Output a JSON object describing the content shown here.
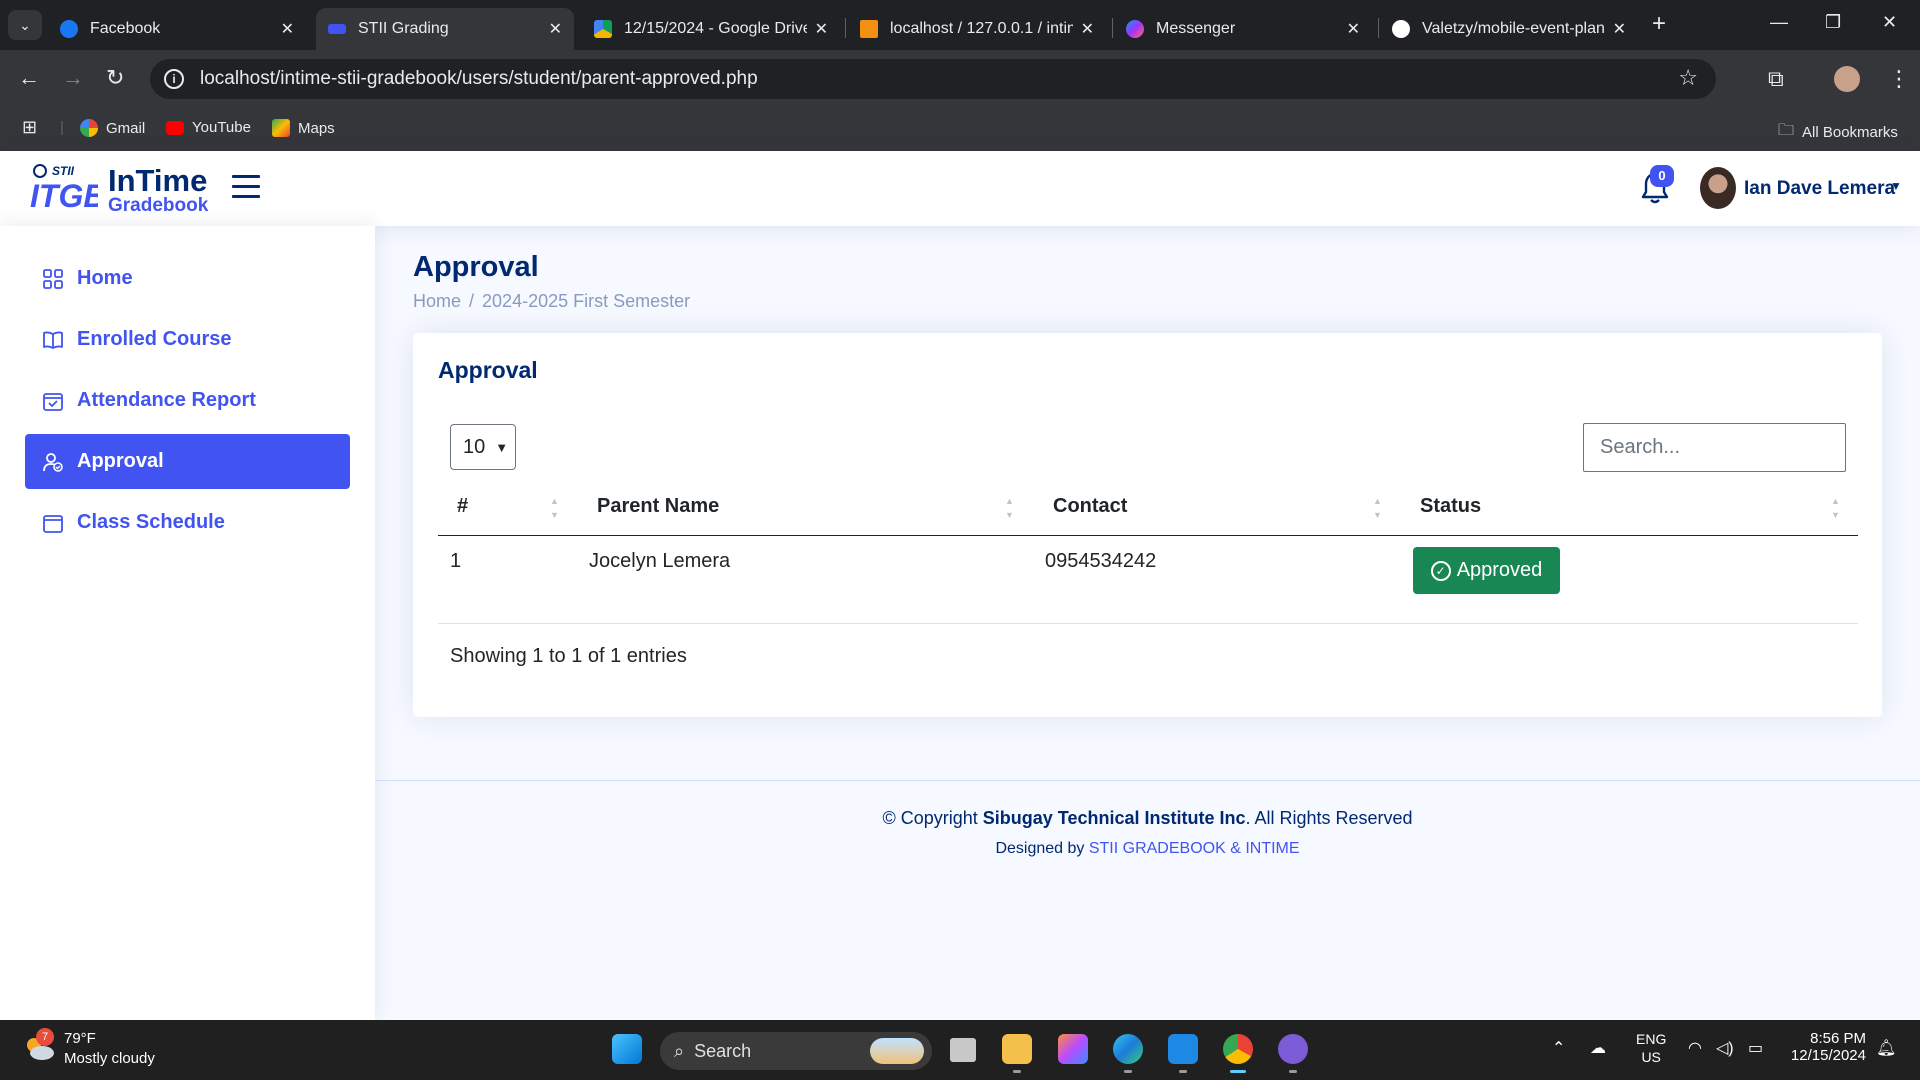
{
  "browser": {
    "tabs": [
      {
        "title": "Facebook",
        "active": false
      },
      {
        "title": "STII Grading",
        "active": true
      },
      {
        "title": "12/15/2024 - Google Drive",
        "active": false
      },
      {
        "title": "localhost / 127.0.0.1 / intim",
        "active": false
      },
      {
        "title": "Messenger",
        "active": false
      },
      {
        "title": "Valetzy/mobile-event-plan",
        "active": false
      }
    ],
    "url": "localhost/intime-stii-gradebook/users/student/parent-approved.php",
    "bookmarks": [
      "Gmail",
      "YouTube",
      "Maps"
    ],
    "all_bookmarks": "All Bookmarks"
  },
  "header": {
    "logo_line1": "InTime",
    "logo_line2": "Gradebook",
    "notification_count": "0",
    "user_name": "Ian Dave Lemera"
  },
  "sidebar": {
    "items": [
      {
        "label": "Home",
        "icon": "grid-icon",
        "active": false
      },
      {
        "label": "Enrolled Course",
        "icon": "book-icon",
        "active": false
      },
      {
        "label": "Attendance Report",
        "icon": "calendar-check-icon",
        "active": false
      },
      {
        "label": "Approval",
        "icon": "person-check-icon",
        "active": true
      },
      {
        "label": "Class Schedule",
        "icon": "calendar-icon",
        "active": false
      }
    ]
  },
  "main": {
    "page_title": "Approval",
    "breadcrumb": [
      "Home",
      "2024-2025 First Semester"
    ],
    "card_title": "Approval",
    "page_length": "10",
    "search_placeholder": "Search...",
    "columns": [
      "#",
      "Parent Name",
      "Contact",
      "Status"
    ],
    "rows": [
      {
        "num": "1",
        "parent_name": "Jocelyn Lemera",
        "contact": "0954534242",
        "status": "Approved"
      }
    ],
    "info": "Showing 1 to 1 of 1 entries"
  },
  "footer": {
    "copyright_prefix": "© Copyright",
    "company": "Sibugay Technical Institute Inc",
    "copyright_suffix": ". All Rights Reserved",
    "designed_prefix": "Designed by",
    "designed_link": "STII GRADEBOOK & INTIME"
  },
  "taskbar": {
    "weather_badge": "7",
    "temperature": "79°F",
    "condition": "Mostly cloudy",
    "search_label": "Search",
    "lang_line1": "ENG",
    "lang_line2": "US",
    "time": "8:56 PM",
    "date": "12/15/2024"
  },
  "colors": {
    "accent": "#4154f1",
    "navy": "#012970",
    "success": "#198754",
    "page_bg": "#f6f9ff"
  }
}
